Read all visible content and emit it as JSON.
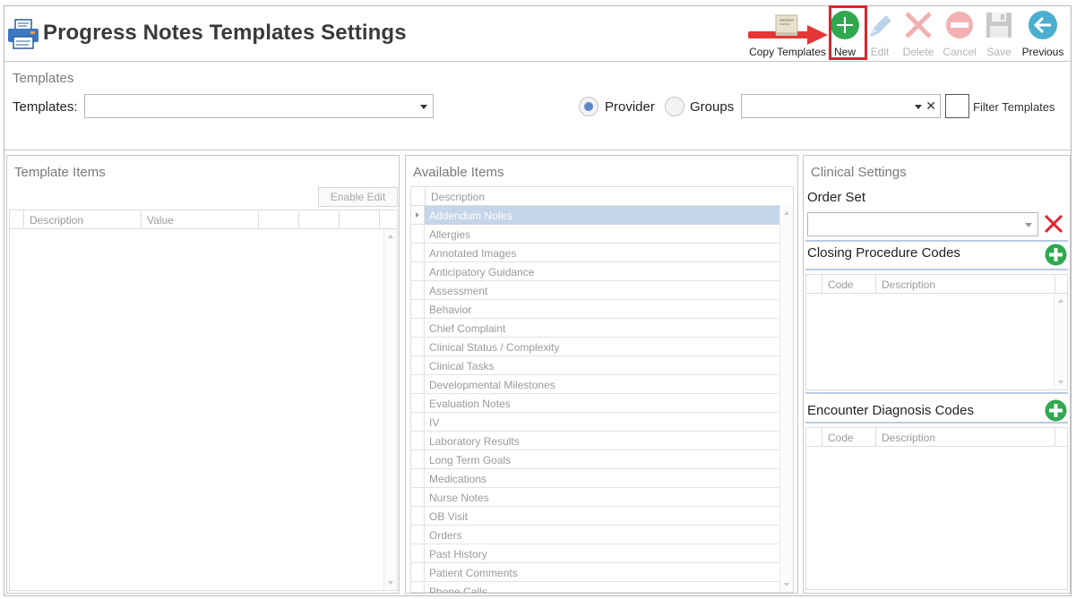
{
  "header": {
    "title": "Progress Notes Templates Settings"
  },
  "toolbar": {
    "copy_templates": "Copy Templates",
    "new": "New",
    "edit": "Edit",
    "delete": "Delete",
    "cancel": "Cancel",
    "save": "Save",
    "previous": "Previous"
  },
  "templates_section": {
    "title": "Templates",
    "templates_label": "Templates:",
    "templates_value": "",
    "provider_label": "Provider",
    "groups_label": "Groups",
    "provider_selected": true,
    "groups_value": "",
    "clear_symbol": "✕",
    "filter_label": "Filter Templates",
    "filter_checked": false
  },
  "template_items": {
    "title": "Template Items",
    "enable_edit": "Enable Edit",
    "columns": [
      "Description",
      "Value",
      "",
      "",
      ""
    ]
  },
  "available_items": {
    "title": "Available Items",
    "column": "Description",
    "selected_index": 0,
    "items": [
      "Addendum Notes",
      "Allergies",
      "Annotated Images",
      "Anticipatory Guidance",
      "Assessment",
      "Behavior",
      "Chief Complaint",
      "Clinical Status / Complexity",
      "Clinical Tasks",
      "Developmental Milestones",
      "Evaluation Notes",
      "IV",
      "Laboratory Results",
      "Long Term Goals",
      "Medications",
      "Nurse Notes",
      "OB Visit",
      "Orders",
      "Past History",
      "Patient Comments",
      "Phone Calls"
    ]
  },
  "clinical_settings": {
    "title": "Clinical Settings",
    "order_set_label": "Order Set",
    "order_set_value": "",
    "closing_label": "Closing Procedure Codes",
    "closing_columns": [
      "Code",
      "Description"
    ],
    "encounter_label": "Encounter Diagnosis Codes",
    "encounter_columns": [
      "Code",
      "Description"
    ]
  },
  "colors": {
    "new_green": "#2fa84f",
    "disabled_blue": "#b9d4ea",
    "disabled_red": "#f2b1b1",
    "previous_teal": "#4aaed0",
    "highlight_red": "#e0242e",
    "selected_row": "#c5d5ea"
  }
}
